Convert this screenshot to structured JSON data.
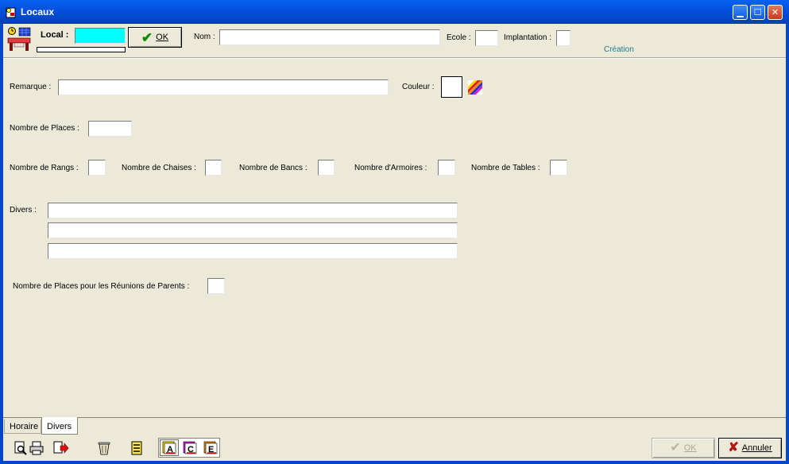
{
  "window": {
    "title": "Locaux",
    "icon": "locaux-app-icon"
  },
  "toolbar": {
    "local_label": "Local :",
    "local_value": "",
    "ok_label": "OK",
    "nom_label": "Nom :",
    "nom_value": "",
    "ecole_label": "Ecole :",
    "ecole_value": "",
    "implantation_label": "Implantation :",
    "implantation_value": "",
    "mode_text": "Création"
  },
  "form": {
    "remarque_label": "Remarque :",
    "remarque_value": "",
    "couleur_label": "Couleur :",
    "places_label": "Nombre de Places :",
    "places_value": "",
    "rangs_label": "Nombre de Rangs :",
    "chaises_label": "Nombre de Chaises :",
    "bancs_label": "Nombre de Bancs :",
    "armoires_label": "Nombre d'Armoires :",
    "tables_label": "Nombre de Tables :",
    "divers_label": "Divers :",
    "divers_lines": [
      "",
      "",
      ""
    ],
    "reunions_label": "Nombre de Places pour les Réunions de Parents :",
    "reunions_value": ""
  },
  "tabs": [
    {
      "label": "Horaire",
      "active": false
    },
    {
      "label": "Divers",
      "active": true
    }
  ],
  "bottom": {
    "ok_label": "OK",
    "annuler_label": "Annuler",
    "icons": [
      "preview-icon",
      "print-icon",
      "export-icon",
      "trash-icon",
      "list-icon",
      "format-a-icon",
      "format-c-icon",
      "format-e-icon"
    ]
  },
  "colors": {
    "local_field": "#00ffff",
    "mode_text": "#1a7c8c",
    "titlebar": "#0346c8",
    "background": "#ece9d8"
  }
}
